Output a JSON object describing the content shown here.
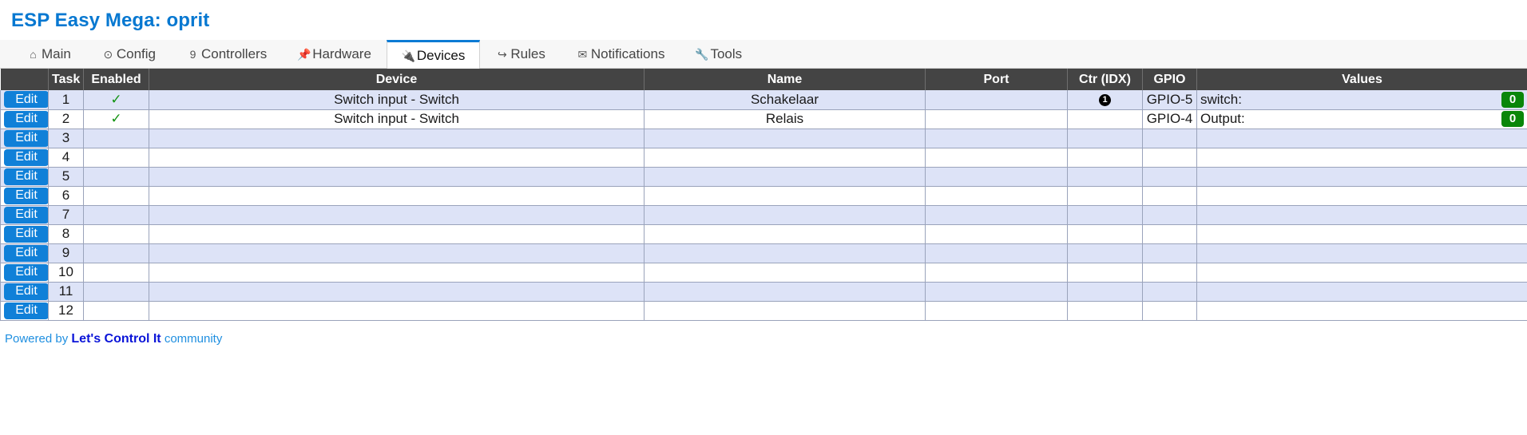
{
  "header": {
    "title": "ESP Easy Mega: oprit",
    "title_color": "#0778d1"
  },
  "tabs": [
    {
      "label": "Main",
      "icon": "home-icon",
      "glyph": "⌂",
      "active": false
    },
    {
      "label": "Config",
      "icon": "gear-icon",
      "glyph": "⊙",
      "active": false
    },
    {
      "label": "Controllers",
      "icon": "chat-icon",
      "glyph": "὞9",
      "active": false
    },
    {
      "label": "Hardware",
      "icon": "pushpin-icon",
      "glyph": "📌",
      "active": false
    },
    {
      "label": "Devices",
      "icon": "plug-icon",
      "glyph": "🔌",
      "active": true
    },
    {
      "label": "Rules",
      "icon": "arrow-branch-icon",
      "glyph": "↪",
      "active": false
    },
    {
      "label": "Notifications",
      "icon": "envelope-icon",
      "glyph": "✉",
      "active": false
    },
    {
      "label": "Tools",
      "icon": "wrench-icon",
      "glyph": "🔧",
      "active": false
    }
  ],
  "table": {
    "columns": [
      {
        "key": "edit",
        "label": ""
      },
      {
        "key": "task",
        "label": "Task"
      },
      {
        "key": "enabled",
        "label": "Enabled"
      },
      {
        "key": "device",
        "label": "Device"
      },
      {
        "key": "name",
        "label": "Name"
      },
      {
        "key": "port",
        "label": "Port"
      },
      {
        "key": "ctr",
        "label": "Ctr (IDX)"
      },
      {
        "key": "gpio",
        "label": "GPIO"
      },
      {
        "key": "values",
        "label": "Values"
      }
    ],
    "edit_label": "Edit",
    "enabled_glyph": "✓",
    "rows": [
      {
        "task": "1",
        "enabled": true,
        "device": "Switch input - Switch",
        "name": "Schakelaar",
        "port": "",
        "ctr": "1",
        "gpio": "GPIO-5",
        "value_label": "switch:",
        "value": "0"
      },
      {
        "task": "2",
        "enabled": true,
        "device": "Switch input - Switch",
        "name": "Relais",
        "port": "",
        "ctr": "",
        "gpio": "GPIO-4",
        "value_label": "Output:",
        "value": "0"
      },
      {
        "task": "3",
        "enabled": false,
        "device": "",
        "name": "",
        "port": "",
        "ctr": "",
        "gpio": "",
        "value_label": "",
        "value": ""
      },
      {
        "task": "4",
        "enabled": false,
        "device": "",
        "name": "",
        "port": "",
        "ctr": "",
        "gpio": "",
        "value_label": "",
        "value": ""
      },
      {
        "task": "5",
        "enabled": false,
        "device": "",
        "name": "",
        "port": "",
        "ctr": "",
        "gpio": "",
        "value_label": "",
        "value": ""
      },
      {
        "task": "6",
        "enabled": false,
        "device": "",
        "name": "",
        "port": "",
        "ctr": "",
        "gpio": "",
        "value_label": "",
        "value": ""
      },
      {
        "task": "7",
        "enabled": false,
        "device": "",
        "name": "",
        "port": "",
        "ctr": "",
        "gpio": "",
        "value_label": "",
        "value": ""
      },
      {
        "task": "8",
        "enabled": false,
        "device": "",
        "name": "",
        "port": "",
        "ctr": "",
        "gpio": "",
        "value_label": "",
        "value": ""
      },
      {
        "task": "9",
        "enabled": false,
        "device": "",
        "name": "",
        "port": "",
        "ctr": "",
        "gpio": "",
        "value_label": "",
        "value": ""
      },
      {
        "task": "10",
        "enabled": false,
        "device": "",
        "name": "",
        "port": "",
        "ctr": "",
        "gpio": "",
        "value_label": "",
        "value": ""
      },
      {
        "task": "11",
        "enabled": false,
        "device": "",
        "name": "",
        "port": "",
        "ctr": "",
        "gpio": "",
        "value_label": "",
        "value": ""
      },
      {
        "task": "12",
        "enabled": false,
        "device": "",
        "name": "",
        "port": "",
        "ctr": "",
        "gpio": "",
        "value_label": "",
        "value": ""
      }
    ]
  },
  "footer": {
    "prefix": "Powered by",
    "brand": "Let's Control It",
    "suffix": "community"
  },
  "colors": {
    "accent": "#0778d1",
    "tab_active_border": "#0c7bd4",
    "header_bg": "#444444",
    "row_alt_bg": "#dde3f7",
    "button_blue": "#1080d8",
    "check_green": "#149414",
    "badge_green": "#098609"
  }
}
